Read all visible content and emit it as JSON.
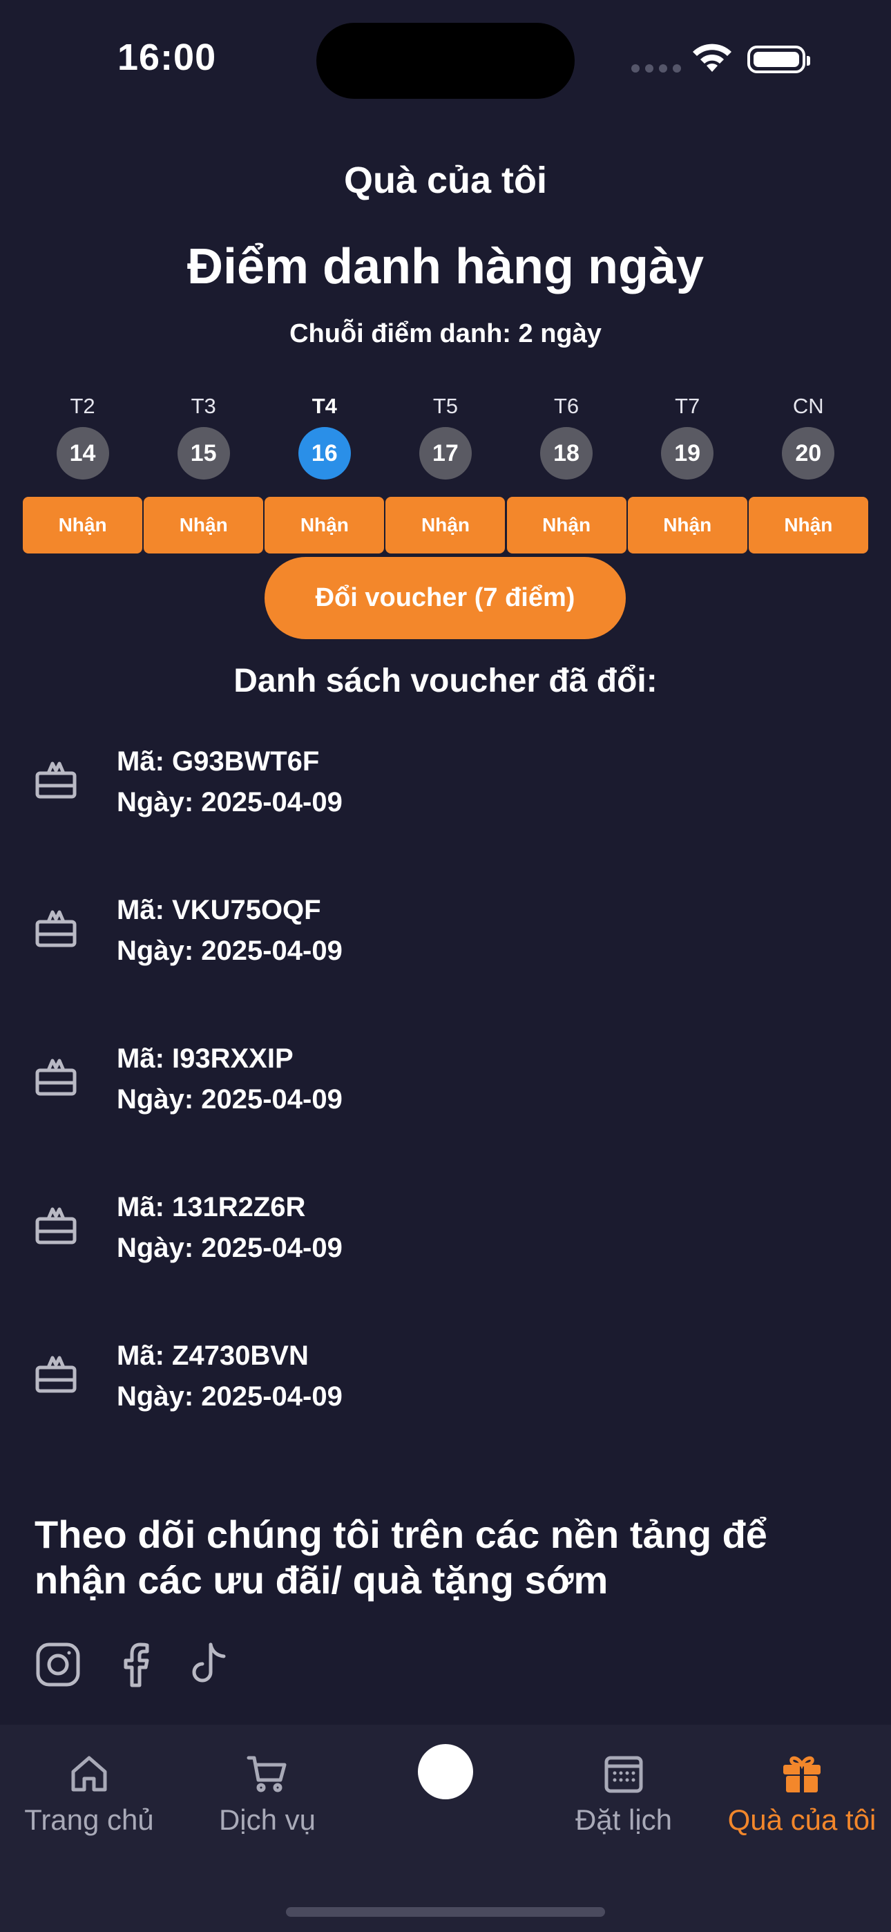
{
  "status_bar": {
    "time": "16:00"
  },
  "header": {
    "title": "Quà của tôi",
    "headline": "Điểm danh hàng ngày",
    "streak": "Chuỗi điểm danh: 2 ngày"
  },
  "week": [
    {
      "label": "T2",
      "date": "14",
      "button": "Nhận",
      "active": false
    },
    {
      "label": "T3",
      "date": "15",
      "button": "Nhận",
      "active": false
    },
    {
      "label": "T4",
      "date": "16",
      "button": "Nhận",
      "active": true
    },
    {
      "label": "T5",
      "date": "17",
      "button": "Nhận",
      "active": false
    },
    {
      "label": "T6",
      "date": "18",
      "button": "Nhận",
      "active": false
    },
    {
      "label": "T7",
      "date": "19",
      "button": "Nhận",
      "active": false
    },
    {
      "label": "CN",
      "date": "20",
      "button": "Nhận",
      "active": false
    }
  ],
  "redeem_button": "Đổi voucher (7 điểm)",
  "voucher_section": {
    "heading": "Danh sách voucher đã đổi:",
    "items": [
      {
        "code": "Mã: G93BWT6F",
        "date": "Ngày: 2025-04-09",
        "icon": "gift-card-icon"
      },
      {
        "code": "Mã: VKU75OQF",
        "date": "Ngày: 2025-04-09",
        "icon": "gift-card-icon"
      },
      {
        "code": "Mã: I93RXXIP",
        "date": "Ngày: 2025-04-09",
        "icon": "gift-card-icon"
      },
      {
        "code": "Mã: 131R2Z6R",
        "date": "Ngày: 2025-04-09",
        "icon": "gift-card-icon"
      },
      {
        "code": "Mã: Z4730BVN",
        "date": "Ngày: 2025-04-09",
        "icon": "gift-card-icon"
      }
    ]
  },
  "follow": {
    "text": "Theo dõi chúng tôi trên các nền tảng để nhận các ưu đãi/ quà tặng sớm",
    "socials": [
      "instagram-icon",
      "facebook-icon",
      "tiktok-icon"
    ]
  },
  "tabbar": {
    "tabs": [
      {
        "label": "Trang chủ",
        "icon": "home-icon"
      },
      {
        "label": "Dịch vụ",
        "icon": "cart-icon"
      },
      {
        "label": "",
        "icon": "center-action"
      },
      {
        "label": "Đặt lịch",
        "icon": "calendar-icon"
      },
      {
        "label": "Quà của tôi",
        "icon": "gift-icon"
      }
    ],
    "active_index": 4
  },
  "colors": {
    "background": "#1b1b2f",
    "accent": "#f3872b",
    "active_day": "#2a8fe8",
    "day_circle": "#5a5a63",
    "tabbar": "#222236"
  }
}
